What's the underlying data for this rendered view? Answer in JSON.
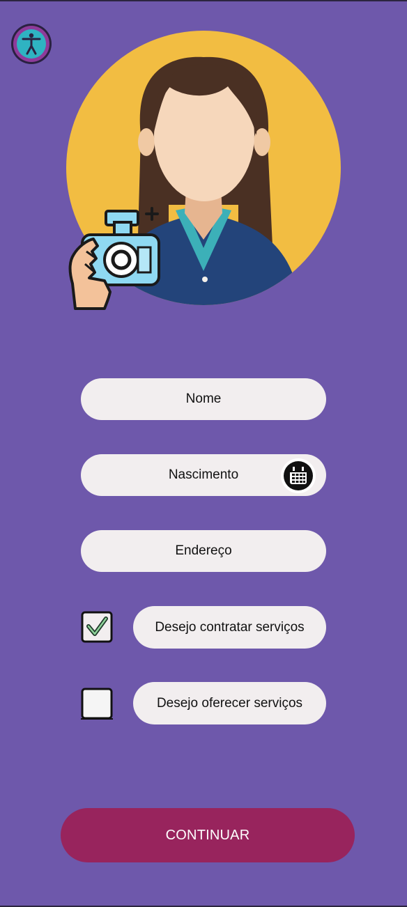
{
  "colors": {
    "background": "#6e58ab",
    "field_bg": "#f2eeef",
    "primary_button": "#98245d",
    "avatar_circle": "#f2bd42"
  },
  "icons": {
    "accessibility": "accessibility-icon",
    "avatar": "user-avatar",
    "camera": "camera-add-icon",
    "calendar": "calendar-icon",
    "checkmark": "check-icon"
  },
  "form": {
    "name_placeholder": "Nome",
    "birth_placeholder": "Nascimento",
    "address_placeholder": "Endereço",
    "options": [
      {
        "label": "Desejo contratar serviços",
        "checked": true
      },
      {
        "label": "Desejo oferecer serviços",
        "checked": false
      }
    ]
  },
  "actions": {
    "continue_label": "CONTINUAR"
  }
}
